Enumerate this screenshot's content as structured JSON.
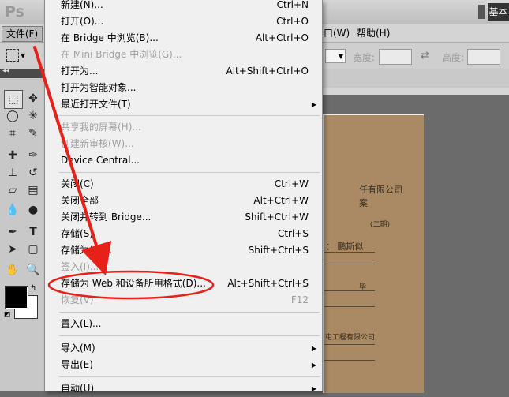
{
  "app": {
    "logo": "Ps",
    "workspace_button": "基本"
  },
  "menubar": {
    "file": "文件(F)",
    "window": "口(W)",
    "help": "帮助(H)"
  },
  "options_bar": {
    "width_label": "宽度:",
    "height_label": "高度:"
  },
  "file_menu": {
    "items": [
      {
        "label": "新建(N)...",
        "shortcut": "Ctrl+N",
        "disabled": false,
        "submenu": false
      },
      {
        "label": "打开(O)...",
        "shortcut": "Ctrl+O",
        "disabled": false,
        "submenu": false
      },
      {
        "label": "在 Bridge 中浏览(B)...",
        "shortcut": "Alt+Ctrl+O",
        "disabled": false,
        "submenu": false
      },
      {
        "label": "在 Mini Bridge 中浏览(G)...",
        "shortcut": "",
        "disabled": true,
        "submenu": false
      },
      {
        "label": "打开为...",
        "shortcut": "Alt+Shift+Ctrl+O",
        "disabled": false,
        "submenu": false
      },
      {
        "label": "打开为智能对象...",
        "shortcut": "",
        "disabled": false,
        "submenu": false
      },
      {
        "label": "最近打开文件(T)",
        "shortcut": "",
        "disabled": false,
        "submenu": true
      },
      {
        "label": "共享我的屏幕(H)...",
        "shortcut": "",
        "disabled": true,
        "submenu": false
      },
      {
        "label": "创建新审核(W)...",
        "shortcut": "",
        "disabled": true,
        "submenu": false
      },
      {
        "label": "Device Central...",
        "shortcut": "",
        "disabled": false,
        "submenu": false
      },
      {
        "label": "关闭(C)",
        "shortcut": "Ctrl+W",
        "disabled": false,
        "submenu": false
      },
      {
        "label": "关闭全部",
        "shortcut": "Alt+Ctrl+W",
        "disabled": false,
        "submenu": false
      },
      {
        "label": "关闭并转到 Bridge...",
        "shortcut": "Shift+Ctrl+W",
        "disabled": false,
        "submenu": false
      },
      {
        "label": "存储(S)",
        "shortcut": "Ctrl+S",
        "disabled": false,
        "submenu": false
      },
      {
        "label": "存储为(A)...",
        "shortcut": "Shift+Ctrl+S",
        "disabled": false,
        "submenu": false
      },
      {
        "label": "签入(I)...",
        "shortcut": "",
        "disabled": true,
        "submenu": false
      },
      {
        "label": "存储为 Web 和设备所用格式(D)...",
        "shortcut": "Alt+Shift+Ctrl+S",
        "disabled": false,
        "submenu": false
      },
      {
        "label": "恢复(V)",
        "shortcut": "F12",
        "disabled": true,
        "submenu": false
      },
      {
        "label": "置入(L)...",
        "shortcut": "",
        "disabled": false,
        "submenu": false
      },
      {
        "label": "导入(M)",
        "shortcut": "",
        "disabled": false,
        "submenu": true
      },
      {
        "label": "导出(E)",
        "shortcut": "",
        "disabled": false,
        "submenu": true
      },
      {
        "label": "自动(U)",
        "shortcut": "",
        "disabled": false,
        "submenu": true
      }
    ]
  },
  "document": {
    "line1": "任有限公司",
    "line2": "案",
    "line3": "(二期)",
    "line4": "：  鹏斯似",
    "line5": "毕",
    "line6": "屯工程有限公司"
  },
  "colors": {
    "annotation": "#e8201a",
    "menu_bg": "#f0f0f0",
    "disabled_text": "#a0a0a0"
  }
}
